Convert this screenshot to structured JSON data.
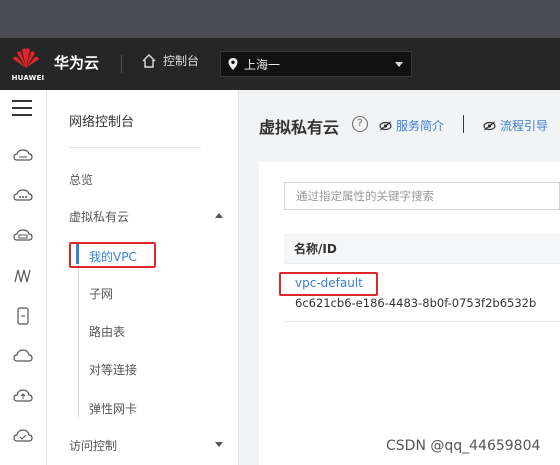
{
  "header": {
    "logo_text": "HUAWEI",
    "brand": "华为云",
    "console": "控制台",
    "region": "上海一"
  },
  "subnav": {
    "title": "网络控制台",
    "overview": "总览",
    "vpc_group": "虚拟私有云",
    "children": [
      "我的VPC",
      "子网",
      "路由表",
      "对等连接",
      "弹性网卡"
    ],
    "access_control": "访问控制"
  },
  "main": {
    "title": "虚拟私有云",
    "help_glyph": "?",
    "service_intro": "服务简介",
    "process_guide": "流程引导",
    "search_placeholder": "通过指定属性的关键字搜索",
    "column_header": "名称/ID",
    "rows": [
      {
        "name": "vpc-default",
        "id": "6c621cb6-e186-4483-8b0f-0753f2b6532b"
      }
    ]
  },
  "watermark": "CSDN @qq_44659804",
  "colors": {
    "accent": "#3a7fd5",
    "highlight": "#e0262b",
    "topbar": "#262626"
  }
}
